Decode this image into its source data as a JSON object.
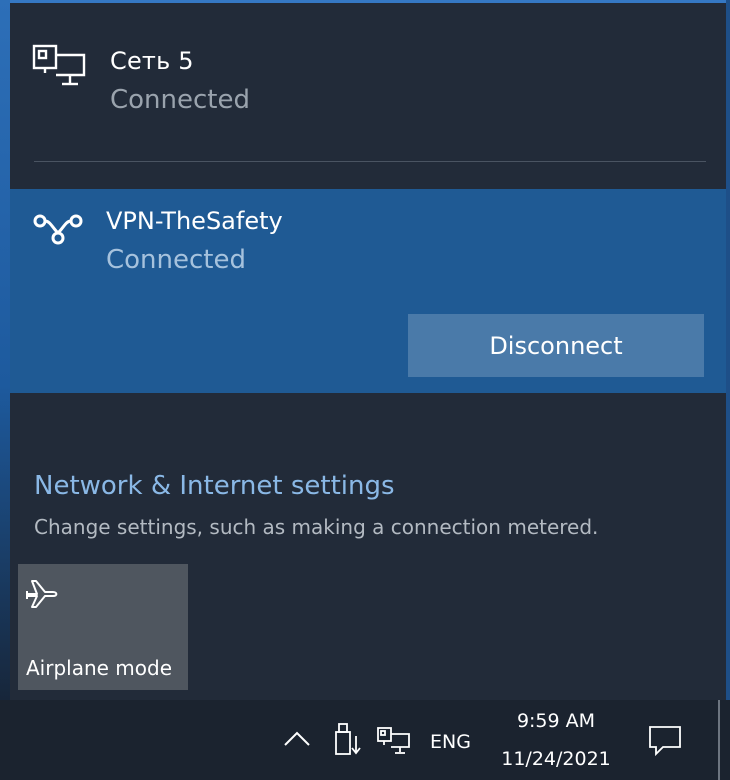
{
  "networks": {
    "ethernet": {
      "name": "Сеть 5",
      "status": "Connected",
      "icon": "ethernet-icon"
    },
    "vpn": {
      "name": "VPN-TheSafety",
      "status": "Connected",
      "icon": "vpn-icon",
      "disconnect_label": "Disconnect"
    }
  },
  "settings": {
    "link_label": "Network & Internet settings",
    "description": "Change settings, such as making a connection metered."
  },
  "quick_actions": [
    {
      "label": "Airplane mode",
      "icon": "airplane-icon",
      "active": false
    }
  ],
  "taskbar": {
    "language": "ENG",
    "time": "9:59 AM",
    "date": "11/24/2021",
    "tray_icons": [
      "chevron-up-icon",
      "usb-drive-icon",
      "network-icon",
      "notification-icon"
    ]
  },
  "colors": {
    "flyout_bg": "#222b39",
    "vpn_selected_bg": "#1f5a94",
    "disconnect_button_bg": "#4a7aa9",
    "link_color": "#8ab8e6",
    "tile_bg": "#4f565f",
    "taskbar_bg": "#1b232f"
  }
}
